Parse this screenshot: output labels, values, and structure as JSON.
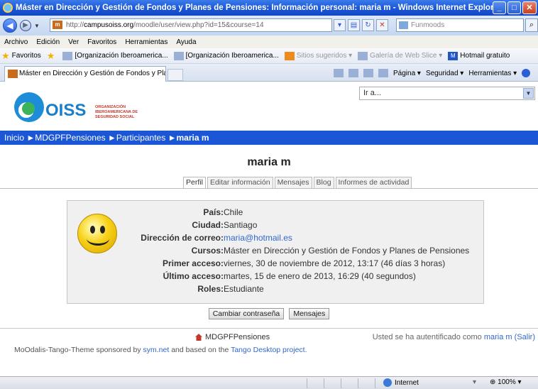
{
  "window": {
    "title": "Máster en Dirección y Gestión de Fondos y Planes de Pensiones: Información personal: maria m - Windows Internet Explorer",
    "buttons": {
      "minimize": "_",
      "maximize": "□",
      "close": "✕"
    }
  },
  "addressbar": {
    "url_prefix": "http://",
    "url_host": "campusoiss.org",
    "url_path": "/moodle/user/view.php?id=15&course=14",
    "search_placeholder": "Funmoods"
  },
  "menubar": [
    "Archivo",
    "Edición",
    "Ver",
    "Favoritos",
    "Herramientas",
    "Ayuda"
  ],
  "favorites": {
    "label": "Favoritos",
    "items": [
      "[Organización Iberoamerica...",
      "[Organización Iberoamerica...",
      "Sitios sugeridos ▾",
      "Galería de Web Slice ▾",
      "Hotmail gratuito"
    ]
  },
  "tab": {
    "title": "Máster en Dirección y Gestión de Fondos y Planes de ..."
  },
  "commandbar": [
    "Página ▾",
    "Seguridad ▾",
    "Herramientas ▾"
  ],
  "page": {
    "logo_text": "OISS",
    "logo_subtext": "ORGANIZACIÓN IBEROAMERICANA DE SEGURIDAD SOCIAL",
    "jump_select": "Ir a...",
    "breadcrumb": {
      "home": "Inicio",
      "course": "MDGPFPensiones",
      "participants": "Participantes",
      "user": "maria m",
      "sep": "►"
    },
    "username": "maria m",
    "tabs": [
      "Perfil",
      "Editar información",
      "Mensajes",
      "Blog",
      "Informes de actividad"
    ],
    "profile": [
      {
        "label": "País:",
        "value": "Chile"
      },
      {
        "label": "Ciudad:",
        "value": "Santiago"
      },
      {
        "label": "Dirección de correo:",
        "value": "maria@hotmail.es"
      },
      {
        "label": "Cursos:",
        "value": "Máster en Dirección y Gestión de Fondos y Planes de Pensiones"
      },
      {
        "label": "Primer acceso:",
        "value": "viernes, 30 de noviembre de 2012, 13:17  (46 días 3 horas)"
      },
      {
        "label": "Último acceso:",
        "value": "martes, 15 de enero de 2013, 16:29  (40 segundos)"
      },
      {
        "label": "Roles:",
        "value": "Estudiante"
      }
    ],
    "buttons": {
      "change_password": "Cambiar contraseña",
      "messages": "Mensajes"
    },
    "footer": {
      "home_link": "MDGPFPensiones",
      "logged_prefix": "Usted se ha autentificado como",
      "logged_user": "maria m",
      "logout": "(Salir)",
      "theme_pre": "MoOdalis-Tango-Theme sponsored by",
      "theme_link1": "sym.net",
      "theme_mid": "and based on the",
      "theme_link2": "Tango Desktop project."
    }
  },
  "statusbar": {
    "zone": "Internet",
    "zoom": "100%"
  },
  "colors": {
    "nav_blue": "#1a56d6",
    "link": "#3366cc"
  }
}
